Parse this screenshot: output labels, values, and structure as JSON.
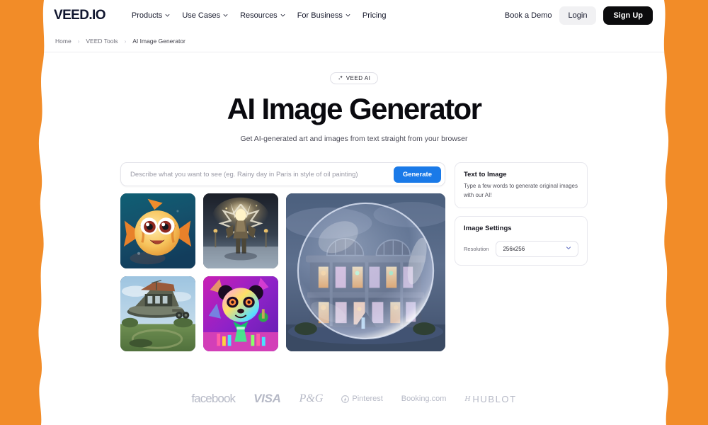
{
  "theme": {
    "frame_orange": "#F28C28",
    "page_bg": "#FFFFFF",
    "accent_blue": "#1A7AE8",
    "logo_navy": "#10162F",
    "signup_black": "#0B0B0D"
  },
  "header": {
    "logo": "VEED.IO",
    "nav": [
      {
        "label": "Products",
        "has_dropdown": true
      },
      {
        "label": "Use Cases",
        "has_dropdown": true
      },
      {
        "label": "Resources",
        "has_dropdown": true
      },
      {
        "label": "For Business",
        "has_dropdown": true
      },
      {
        "label": "Pricing",
        "has_dropdown": false
      }
    ],
    "book_demo": "Book a Demo",
    "login": "Login",
    "signup": "Sign Up"
  },
  "breadcrumb": {
    "separator": "›",
    "items": [
      "Home",
      "VEED Tools",
      "AI Image Generator"
    ]
  },
  "hero": {
    "badge": "VEED AI",
    "badge_icon": "sparkle-icon",
    "title": "AI Image Generator",
    "subtitle": "Get AI-generated art and images from text straight from your browser"
  },
  "prompt": {
    "value": "",
    "placeholder": "Describe what you want to see (eg. Rainy day in Paris in style of oil painting)",
    "generate_label": "Generate"
  },
  "gallery": {
    "thumbnails": [
      {
        "name": "cartoon-clownfish",
        "alt": "Cartoon orange clownfish with big eyes underwater"
      },
      {
        "name": "fantasy-warrior",
        "alt": "Fantasy armored warrior with glowing winged blades"
      },
      {
        "name": "floating-house",
        "alt": "Futuristic floating house over green lawn"
      },
      {
        "name": "neon-panda-scientist",
        "alt": "Neon psychedelic panda scientist with flasks"
      }
    ],
    "feature": {
      "name": "bubble-house",
      "alt": "Illuminated mansion enclosed in a glass bubble at dusk"
    }
  },
  "panels": {
    "text_to_image": {
      "title": "Text to Image",
      "description": "Type a few words to generate original images with our AI!"
    },
    "image_settings": {
      "title": "Image Settings",
      "resolution_label": "Resolution",
      "resolution_value": "256x256"
    }
  },
  "brands": [
    {
      "name": "facebook",
      "label": "facebook"
    },
    {
      "name": "visa",
      "label": "VISA"
    },
    {
      "name": "pg",
      "label": "P&G"
    },
    {
      "name": "pinterest",
      "label": "Pinterest"
    },
    {
      "name": "booking",
      "label": "Booking.com"
    },
    {
      "name": "hublot",
      "label": "HUBLOT"
    }
  ]
}
